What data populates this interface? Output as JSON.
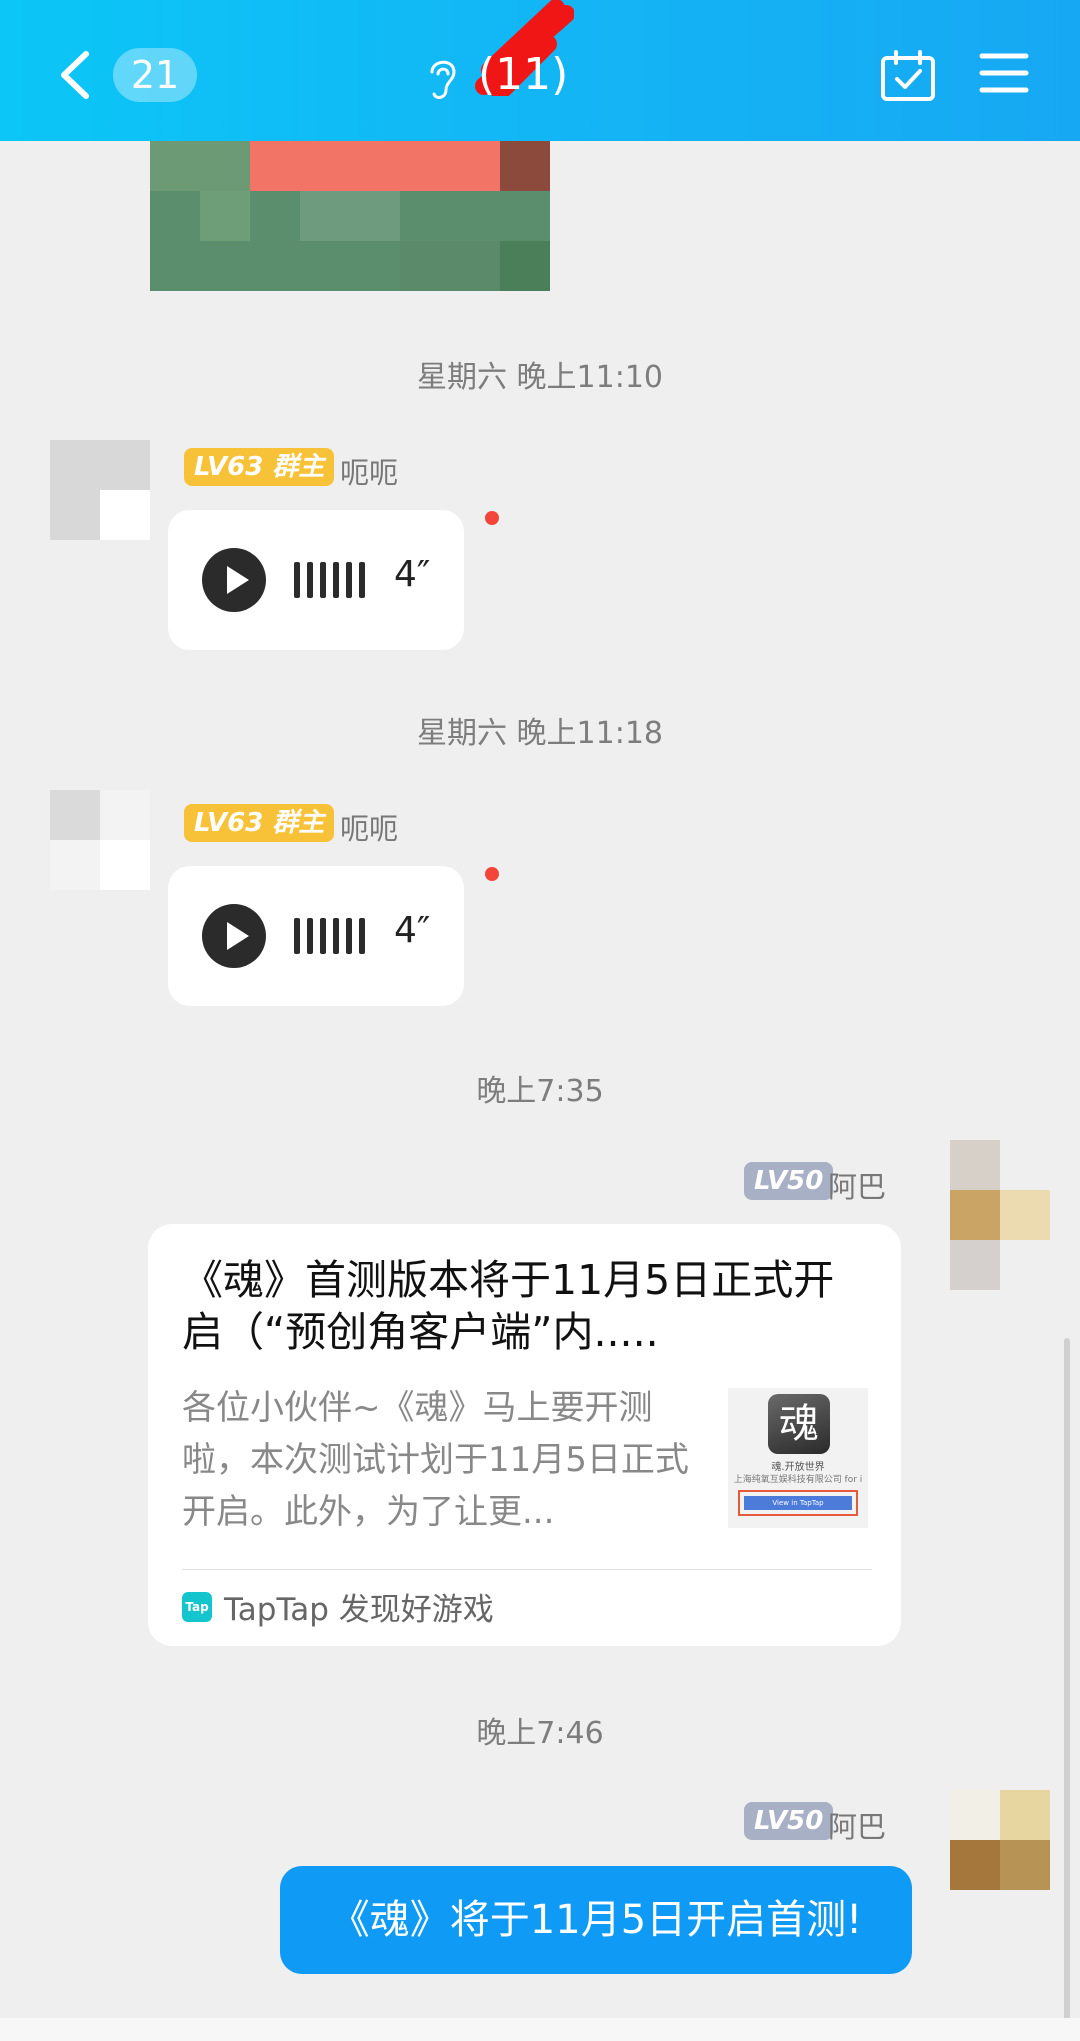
{
  "header": {
    "back_count": "21",
    "title": "(11)",
    "colors": {
      "background": "#12b4f5",
      "text": "#ffffff"
    },
    "icons": [
      "back-chevron-icon",
      "ear-icon",
      "calendar-check-icon",
      "menu-icon"
    ]
  },
  "messages": [
    {
      "type": "time",
      "text": "星期六 晚上11:10"
    },
    {
      "type": "voice",
      "level": "LV63",
      "role": "群主",
      "nickname": "呃呃",
      "duration": "4″",
      "unread": true
    },
    {
      "type": "time",
      "text": "星期六 晚上11:18"
    },
    {
      "type": "voice",
      "level": "LV63",
      "role": "群主",
      "nickname": "呃呃",
      "duration": "4″",
      "unread": true
    },
    {
      "type": "time",
      "text": "晚上7:35"
    },
    {
      "type": "share_card",
      "level": "LV50",
      "nickname": "阿巴",
      "title": "《魂》首测版本将于11月5日正式开启（“预创角客户端”内.....",
      "description": "各位小伙伴~《魂》马上要开测啦，本次测试计划于11月5日正式开启。此外，为了让更...",
      "thumb_glyph": "魂",
      "thumb_line1": "魂.开放世界",
      "thumb_line2": "上海纯氧互娱科技有限公司 for i",
      "thumb_button": "View in TapTap",
      "source": "TapTap 发现好游戏",
      "source_icon": "Tap"
    },
    {
      "type": "time",
      "text": "晚上7:46"
    },
    {
      "type": "text",
      "level": "LV50",
      "nickname": "阿巴",
      "text": "《魂》将于11月5日开启首测!"
    }
  ],
  "colors": {
    "owner_badge": "#f7c237",
    "level_badge": "#a8b0c5",
    "unread_dot": "#f4453a",
    "my_bubble": "#0f9af6",
    "background": "#efefef"
  }
}
